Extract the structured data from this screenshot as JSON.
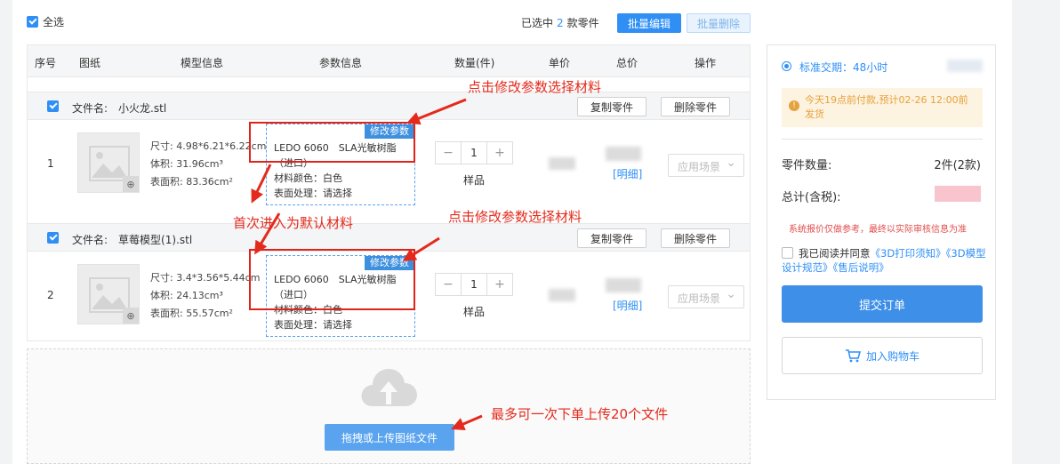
{
  "toolbar": {
    "select_all": "全选",
    "selected_prefix": "已选中",
    "selected_count": "2",
    "selected_suffix": "款零件",
    "batch_edit": "批量编辑",
    "batch_delete": "批量删除"
  },
  "table": {
    "headers": [
      "序号",
      "图纸",
      "模型信息",
      "参数信息",
      "数量(件)",
      "单价",
      "总价",
      "操作"
    ],
    "file_label": "文件名:",
    "copy_part": "复制零件",
    "delete_part": "删除零件",
    "rows": [
      {
        "index": "1",
        "filename": "小火龙.stl",
        "size": "尺寸: 4.98*6.21*6.22cm",
        "volume": "体积: 31.96cm³",
        "area": "表面积: 83.36cm²",
        "param_tag": "修改参数",
        "material": "LEDO 6060　SLA光敏树脂（进口）",
        "color": "材料颜色：白色",
        "surface": "表面处理：请选择",
        "quantity": "1",
        "sample": "样品",
        "detail": "[明细]",
        "scene": "应用场景"
      },
      {
        "index": "2",
        "filename": "草莓模型(1).stl",
        "size": "尺寸: 3.4*3.56*5.44cm",
        "volume": "体积: 24.13cm³",
        "area": "表面积: 55.57cm²",
        "param_tag": "修改参数",
        "material": "LEDO 6060　SLA光敏树脂（进口）",
        "color": "材料颜色：白色",
        "surface": "表面处理：请选择",
        "quantity": "1",
        "sample": "样品",
        "detail": "[明细]",
        "scene": "应用场景"
      }
    ]
  },
  "upload": {
    "button": "拖拽或上传图纸文件"
  },
  "sidebar": {
    "delivery": "标准交期：48小时",
    "notice": "今天19点前付款,预计02-26 12:00前发货",
    "part_count_label": "零件数量:",
    "part_count_value": "2件(2款)",
    "total_label": "总计(含税):",
    "warning": "系统报价仅做参考，最终以实际审核信息为准",
    "agree_prefix": "我已阅读并同意",
    "agree_link1": "《3D打印须知》",
    "agree_link2": "《3D模型设计规范》",
    "agree_link3": "《售后说明》",
    "submit": "提交订单",
    "add_cart": "加入购物车"
  },
  "annotations": {
    "a1": "点击修改参数选择材料",
    "a2": "首次进入为默认材料",
    "a3": "点击修改参数选择材料",
    "a4": "最多可一次下单上传20个文件"
  },
  "colors": {
    "accent": "#2f8ff5",
    "annotation": "#e32a1c",
    "warning": "#e6a23c"
  }
}
